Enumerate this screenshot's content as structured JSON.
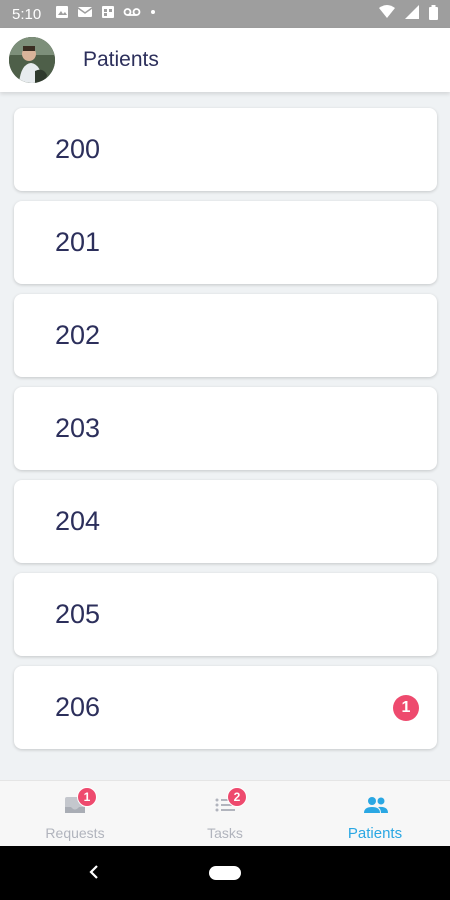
{
  "status_bar": {
    "time": "5:10",
    "icons": [
      "image-icon",
      "mail-icon",
      "calendar-icon",
      "voicemail-icon",
      "dot-icon",
      "wifi-icon",
      "signal-icon",
      "battery-icon"
    ]
  },
  "app_bar": {
    "title": "Patients"
  },
  "patients": [
    {
      "label": "200",
      "badge": ""
    },
    {
      "label": "201",
      "badge": ""
    },
    {
      "label": "202",
      "badge": ""
    },
    {
      "label": "203",
      "badge": ""
    },
    {
      "label": "204",
      "badge": ""
    },
    {
      "label": "205",
      "badge": ""
    },
    {
      "label": "206",
      "badge": "1"
    }
  ],
  "bottom_nav": {
    "requests": {
      "label": "Requests",
      "badge": "1"
    },
    "tasks": {
      "label": "Tasks",
      "badge": "2"
    },
    "patients": {
      "label": "Patients"
    }
  },
  "colors": {
    "accent": "#2aa7e3",
    "badge": "#ee4a6e",
    "title_text": "#2c2f5b"
  }
}
